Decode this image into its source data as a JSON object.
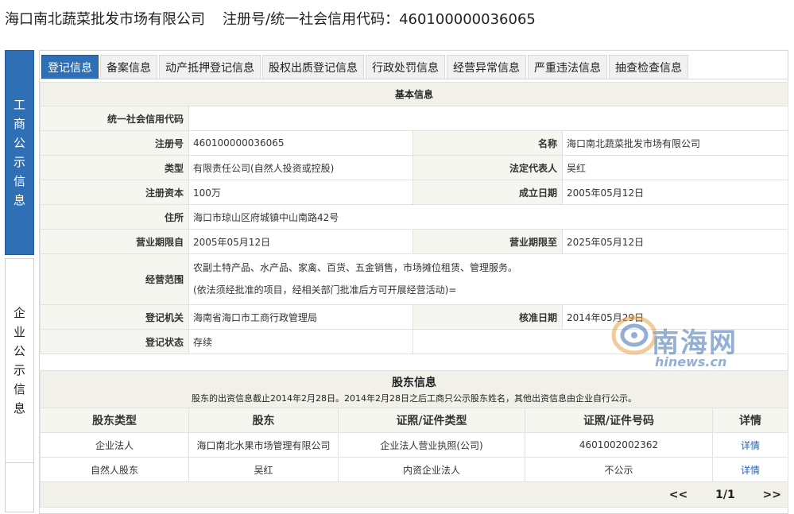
{
  "header": {
    "company": "海口南北蔬菜批发市场有限公司",
    "reg_label": "注册号/统一社会信用代码：460100000036065"
  },
  "left_rail": {
    "gongshang": [
      "工",
      "商",
      "公",
      "示",
      "信",
      "息"
    ],
    "qiye": [
      "企",
      "业",
      "公",
      "示",
      "信",
      "息"
    ]
  },
  "tabs": [
    "登记信息",
    "备案信息",
    "动产抵押登记信息",
    "股权出质登记信息",
    "行政处罚信息",
    "经营异常信息",
    "严重违法信息",
    "抽查检查信息"
  ],
  "basic": {
    "title": "基本信息",
    "credit_code_label": "统一社会信用代码",
    "credit_code": "",
    "reg_no_label": "注册号",
    "reg_no": "460100000036065",
    "name_label": "名称",
    "name": "海口南北蔬菜批发市场有限公司",
    "type_label": "类型",
    "type": "有限责任公司(自然人投资或控股)",
    "legal_rep_label": "法定代表人",
    "legal_rep": "吴红",
    "capital_label": "注册资本",
    "capital": "100万",
    "founded_label": "成立日期",
    "founded": "2005年05月12日",
    "address_label": "住所",
    "address": "海口市琼山区府城镇中山南路42号",
    "term_from_label": "营业期限自",
    "term_from": "2005年05月12日",
    "term_to_label": "营业期限至",
    "term_to": "2025年05月12日",
    "scope_label": "经营范围",
    "scope_line1": "农副土特产品、水产品、家禽、百货、五金销售，市场摊位租赁、管理服务。",
    "scope_line2": "(依法须经批准的项目，经相关部门批准后方可开展经营活动)=",
    "authority_label": "登记机关",
    "authority": "海南省海口市工商行政管理局",
    "approved_label": "核准日期",
    "approved": "2014年05月29日",
    "status_label": "登记状态",
    "status": "存续"
  },
  "shareholders": {
    "title": "股东信息",
    "note": "股东的出资信息截止2014年2月28日。2014年2月28日之后工商只公示股东姓名，其他出资信息由企业自行公示。",
    "columns": [
      "股东类型",
      "股东",
      "证照/证件类型",
      "证照/证件号码",
      "详情"
    ],
    "rows": [
      [
        "企业法人",
        "海口南北水果市场管理有限公司",
        "企业法人营业执照(公司)",
        "4601002002362",
        "详情"
      ],
      [
        "自然人股东",
        "吴红",
        "内资企业法人",
        "不公示",
        "详情"
      ]
    ],
    "pager": {
      "prev": "<<",
      "page": "1/1",
      "next": ">>"
    }
  },
  "watermark": {
    "cn": "南海网",
    "en": "hinews.cn"
  }
}
